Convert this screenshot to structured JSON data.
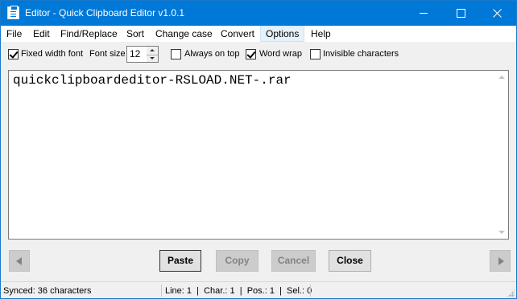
{
  "window": {
    "title": "Editor - Quick Clipboard Editor v1.0.1"
  },
  "menu": [
    "File",
    "Edit",
    "Find/Replace",
    "Sort",
    "Change case",
    "Convert",
    "Options",
    "Help"
  ],
  "toolbar": {
    "fixed_width_font": {
      "label": "Fixed width font",
      "checked": true
    },
    "font_size_label": "Font size",
    "font_size_value": "12",
    "always_on_top": {
      "label": "Always on top",
      "checked": false
    },
    "word_wrap": {
      "label": "Word wrap",
      "checked": true
    },
    "invisible_characters": {
      "label": "Invisible characters",
      "checked": false
    }
  },
  "editor": {
    "text": "quickclipboardeditor-RSLOAD.NET-.rar"
  },
  "buttons": {
    "paste": "Paste",
    "copy": "Copy",
    "cancel": "Cancel",
    "close": "Close"
  },
  "status": {
    "synced": "Synced: 36 characters",
    "position": "Line: 1  |  Char.: 1  |  Pos.: 1  |  Sel.: 0"
  },
  "colors": {
    "titlebar": "#0078d7",
    "menu_active": "#e5f1fb"
  }
}
